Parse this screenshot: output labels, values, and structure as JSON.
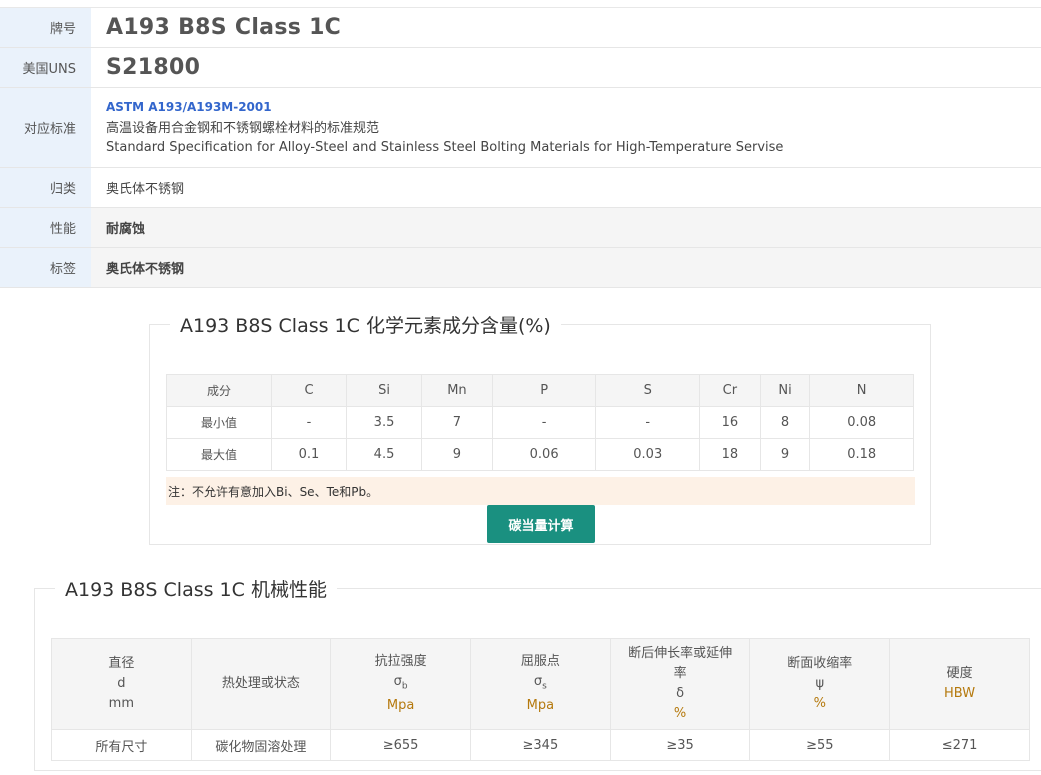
{
  "info": {
    "grade_label": "牌号",
    "grade": "A193 B8S Class 1C",
    "uns_label": "美国UNS",
    "uns": "S21800",
    "standard_label": "对应标准",
    "standard_code": "ASTM A193/A193M-2001",
    "standard_cn": "高温设备用合金钢和不锈钢螺栓材料的标准规范",
    "standard_en": "Standard Specification for Alloy-Steel and Stainless Steel Bolting Materials for High-Temperature Servise",
    "category_label": "归类",
    "category": "奥氏体不锈钢",
    "performance_label": "性能",
    "performance": "耐腐蚀",
    "tag_label": "标签",
    "tag": "奥氏体不锈钢"
  },
  "chem": {
    "title_prefix": "A193 B8S Class 1C",
    "title_suffix": " 化学元素成分含量(%)",
    "header": [
      "成分",
      "C",
      "Si",
      "Mn",
      "P",
      "S",
      "Cr",
      "Ni",
      "N"
    ],
    "rows": [
      [
        "最小值",
        "-",
        "3.5",
        "7",
        "-",
        "-",
        "16",
        "8",
        "0.08"
      ],
      [
        "最大值",
        "0.1",
        "4.5",
        "9",
        "0.06",
        "0.03",
        "18",
        "9",
        "0.18"
      ]
    ],
    "note": "注：不允许有意加入Bi、Se、Te和Pb。",
    "button": "碳当量计算"
  },
  "mech": {
    "title_prefix": "A193 B8S Class 1C",
    "title_suffix": " 机械性能",
    "headers": {
      "diameter": [
        "直径",
        "d",
        "mm"
      ],
      "treatment": "热处理或状态",
      "tensile": [
        "抗拉强度",
        "σ",
        "b",
        "Mpa"
      ],
      "yield": [
        "屈服点",
        "σ",
        "s",
        "Mpa"
      ],
      "elongation": [
        "断后伸长率或延伸",
        "率",
        "δ",
        "%"
      ],
      "reduction": [
        "断面收缩率",
        "ψ",
        "%"
      ],
      "hardness": [
        "硬度",
        "HBW"
      ]
    },
    "row": [
      "所有尺寸",
      "碳化物固溶处理",
      "≥655",
      "≥345",
      "≥35",
      "≥55",
      "≤271"
    ]
  },
  "colors": {
    "label_bg": "#eaf2fb",
    "link": "#3366cc",
    "button": "#1a9080",
    "note_bg": "#fdf1e6",
    "unit": "#b5790d"
  }
}
